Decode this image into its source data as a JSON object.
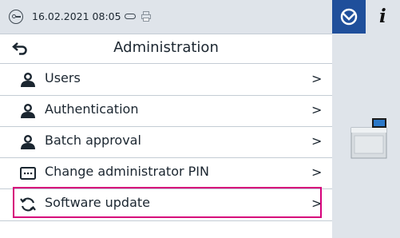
{
  "status_bar": {
    "date_time": "16.02.2021 08:05",
    "icons": [
      "key-icon",
      "usb-icon",
      "printer-icon"
    ]
  },
  "tabs": {
    "settings_tab_icon": "device-sync-icon",
    "info_tab_label": "i"
  },
  "header": {
    "title": "Administration",
    "back_icon": "back-arrow-icon"
  },
  "menu": {
    "items": [
      {
        "label": "Users",
        "icon": "user-icon",
        "chevron": ">"
      },
      {
        "label": "Authentication",
        "icon": "user-icon",
        "chevron": ">"
      },
      {
        "label": "Batch approval",
        "icon": "user-icon",
        "chevron": ">"
      },
      {
        "label": "Change administrator PIN",
        "icon": "pin-keypad-icon",
        "chevron": ">"
      },
      {
        "label": "Software update",
        "icon": "refresh-icon",
        "chevron": ">",
        "highlighted": true
      }
    ]
  },
  "colors": {
    "accent_blue": "#1f4f9b",
    "highlight_magenta": "#d6007a",
    "panel_gray": "#dfe4ea"
  }
}
